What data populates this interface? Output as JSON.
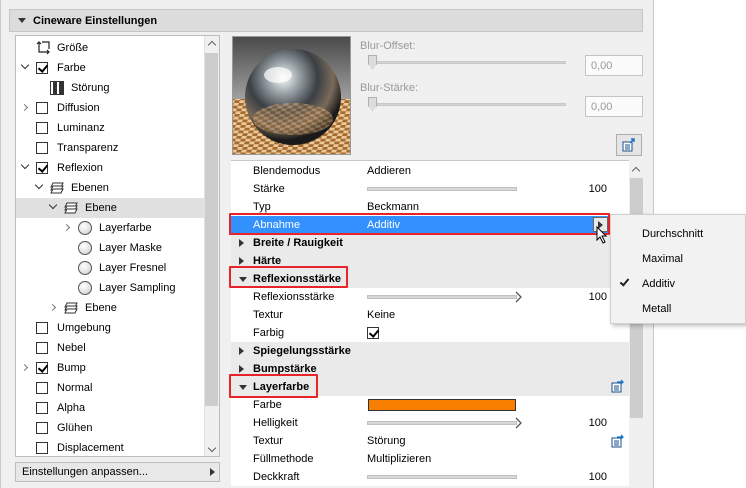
{
  "panel": {
    "title": "Cineware Einstellungen"
  },
  "tree": {
    "items": [
      {
        "label": "Größe",
        "icon": "size-icon",
        "expand": "none",
        "checkbox": null
      },
      {
        "label": "Farbe",
        "expand": "down",
        "checkbox": true
      },
      {
        "label": "Störung",
        "icon": "noise-icon",
        "expand": "none",
        "checkbox": null
      },
      {
        "label": "Diffusion",
        "expand": "right",
        "checkbox": false
      },
      {
        "label": "Luminanz",
        "expand": "none",
        "checkbox": false
      },
      {
        "label": "Transparenz",
        "expand": "none",
        "checkbox": false
      },
      {
        "label": "Reflexion",
        "expand": "down",
        "checkbox": true
      },
      {
        "label": "Ebenen",
        "icon": "layers-icon",
        "expand": "down",
        "checkbox": null
      },
      {
        "label": "Ebene",
        "icon": "layers-icon",
        "expand": "down",
        "checkbox": null,
        "selected": true
      },
      {
        "label": "Layerfarbe",
        "icon": "radio",
        "expand": "right",
        "checkbox": null
      },
      {
        "label": "Layer Maske",
        "icon": "radio",
        "expand": "none",
        "checkbox": null
      },
      {
        "label": "Layer Fresnel",
        "icon": "radio",
        "expand": "none",
        "checkbox": null
      },
      {
        "label": "Layer Sampling",
        "icon": "radio",
        "expand": "none",
        "checkbox": null
      },
      {
        "label": "Ebene",
        "icon": "layers-icon",
        "expand": "right",
        "checkbox": null
      },
      {
        "label": "Umgebung",
        "expand": "none",
        "checkbox": false
      },
      {
        "label": "Nebel",
        "expand": "none",
        "checkbox": false
      },
      {
        "label": "Bump",
        "expand": "right",
        "checkbox": true
      },
      {
        "label": "Normal",
        "expand": "none",
        "checkbox": false
      },
      {
        "label": "Alpha",
        "expand": "none",
        "checkbox": false
      },
      {
        "label": "Glühen",
        "expand": "none",
        "checkbox": false
      },
      {
        "label": "Displacement",
        "expand": "none",
        "checkbox": false
      }
    ]
  },
  "customize": {
    "label": "Einstellungen anpassen..."
  },
  "blur": {
    "offset_label": "Blur-Offset:",
    "offset_value": "0,00",
    "strength_label": "Blur-Stärke:",
    "strength_value": "0,00"
  },
  "props": {
    "rows": [
      {
        "type": "field",
        "name": "Blendemodus",
        "value": "Addieren"
      },
      {
        "type": "slider",
        "name": "Stärke",
        "fraction": 1.0,
        "number": "100"
      },
      {
        "type": "field",
        "name": "Typ",
        "value": "Beckmann"
      },
      {
        "type": "field",
        "name": "Abnahme",
        "value": "Additiv",
        "selected": true
      },
      {
        "type": "section",
        "name": "Breite / Rauigkeit",
        "expanded": false
      },
      {
        "type": "section",
        "name": "Härte",
        "expanded": false
      },
      {
        "type": "section",
        "name": "Reflexionsstärke",
        "expanded": true
      },
      {
        "type": "slider",
        "name": "Reflexionsstärke",
        "fraction": 1.0,
        "number": "100",
        "thumb": true
      },
      {
        "type": "field",
        "name": "Textur",
        "value": "Keine"
      },
      {
        "type": "checkbox",
        "name": "Farbig",
        "checked": true
      },
      {
        "type": "section",
        "name": "Spiegelungsstärke",
        "expanded": false
      },
      {
        "type": "section",
        "name": "Bumpstärke",
        "expanded": false
      },
      {
        "type": "section",
        "name": "Layerfarbe",
        "expanded": true,
        "icon": true
      },
      {
        "type": "color",
        "name": "Farbe",
        "color": "#f77f00"
      },
      {
        "type": "slider",
        "name": "Helligkeit",
        "fraction": 1.0,
        "number": "100",
        "thumb": true
      },
      {
        "type": "field",
        "name": "Textur",
        "value": "Störung",
        "icon": true
      },
      {
        "type": "field",
        "name": "Füllmethode",
        "value": "Multiplizieren"
      },
      {
        "type": "slider",
        "name": "Deckkraft",
        "fraction": 1.0,
        "number": "100"
      }
    ]
  },
  "popup": {
    "items": [
      {
        "label": "Durchschnitt",
        "checked": false
      },
      {
        "label": "Maximal",
        "checked": false
      },
      {
        "label": "Additiv",
        "checked": true
      },
      {
        "label": "Metall",
        "checked": false
      }
    ]
  },
  "colors": {
    "selection": "#3390ff",
    "highlight": "#e8232a",
    "layer_color": "#f77f00"
  }
}
